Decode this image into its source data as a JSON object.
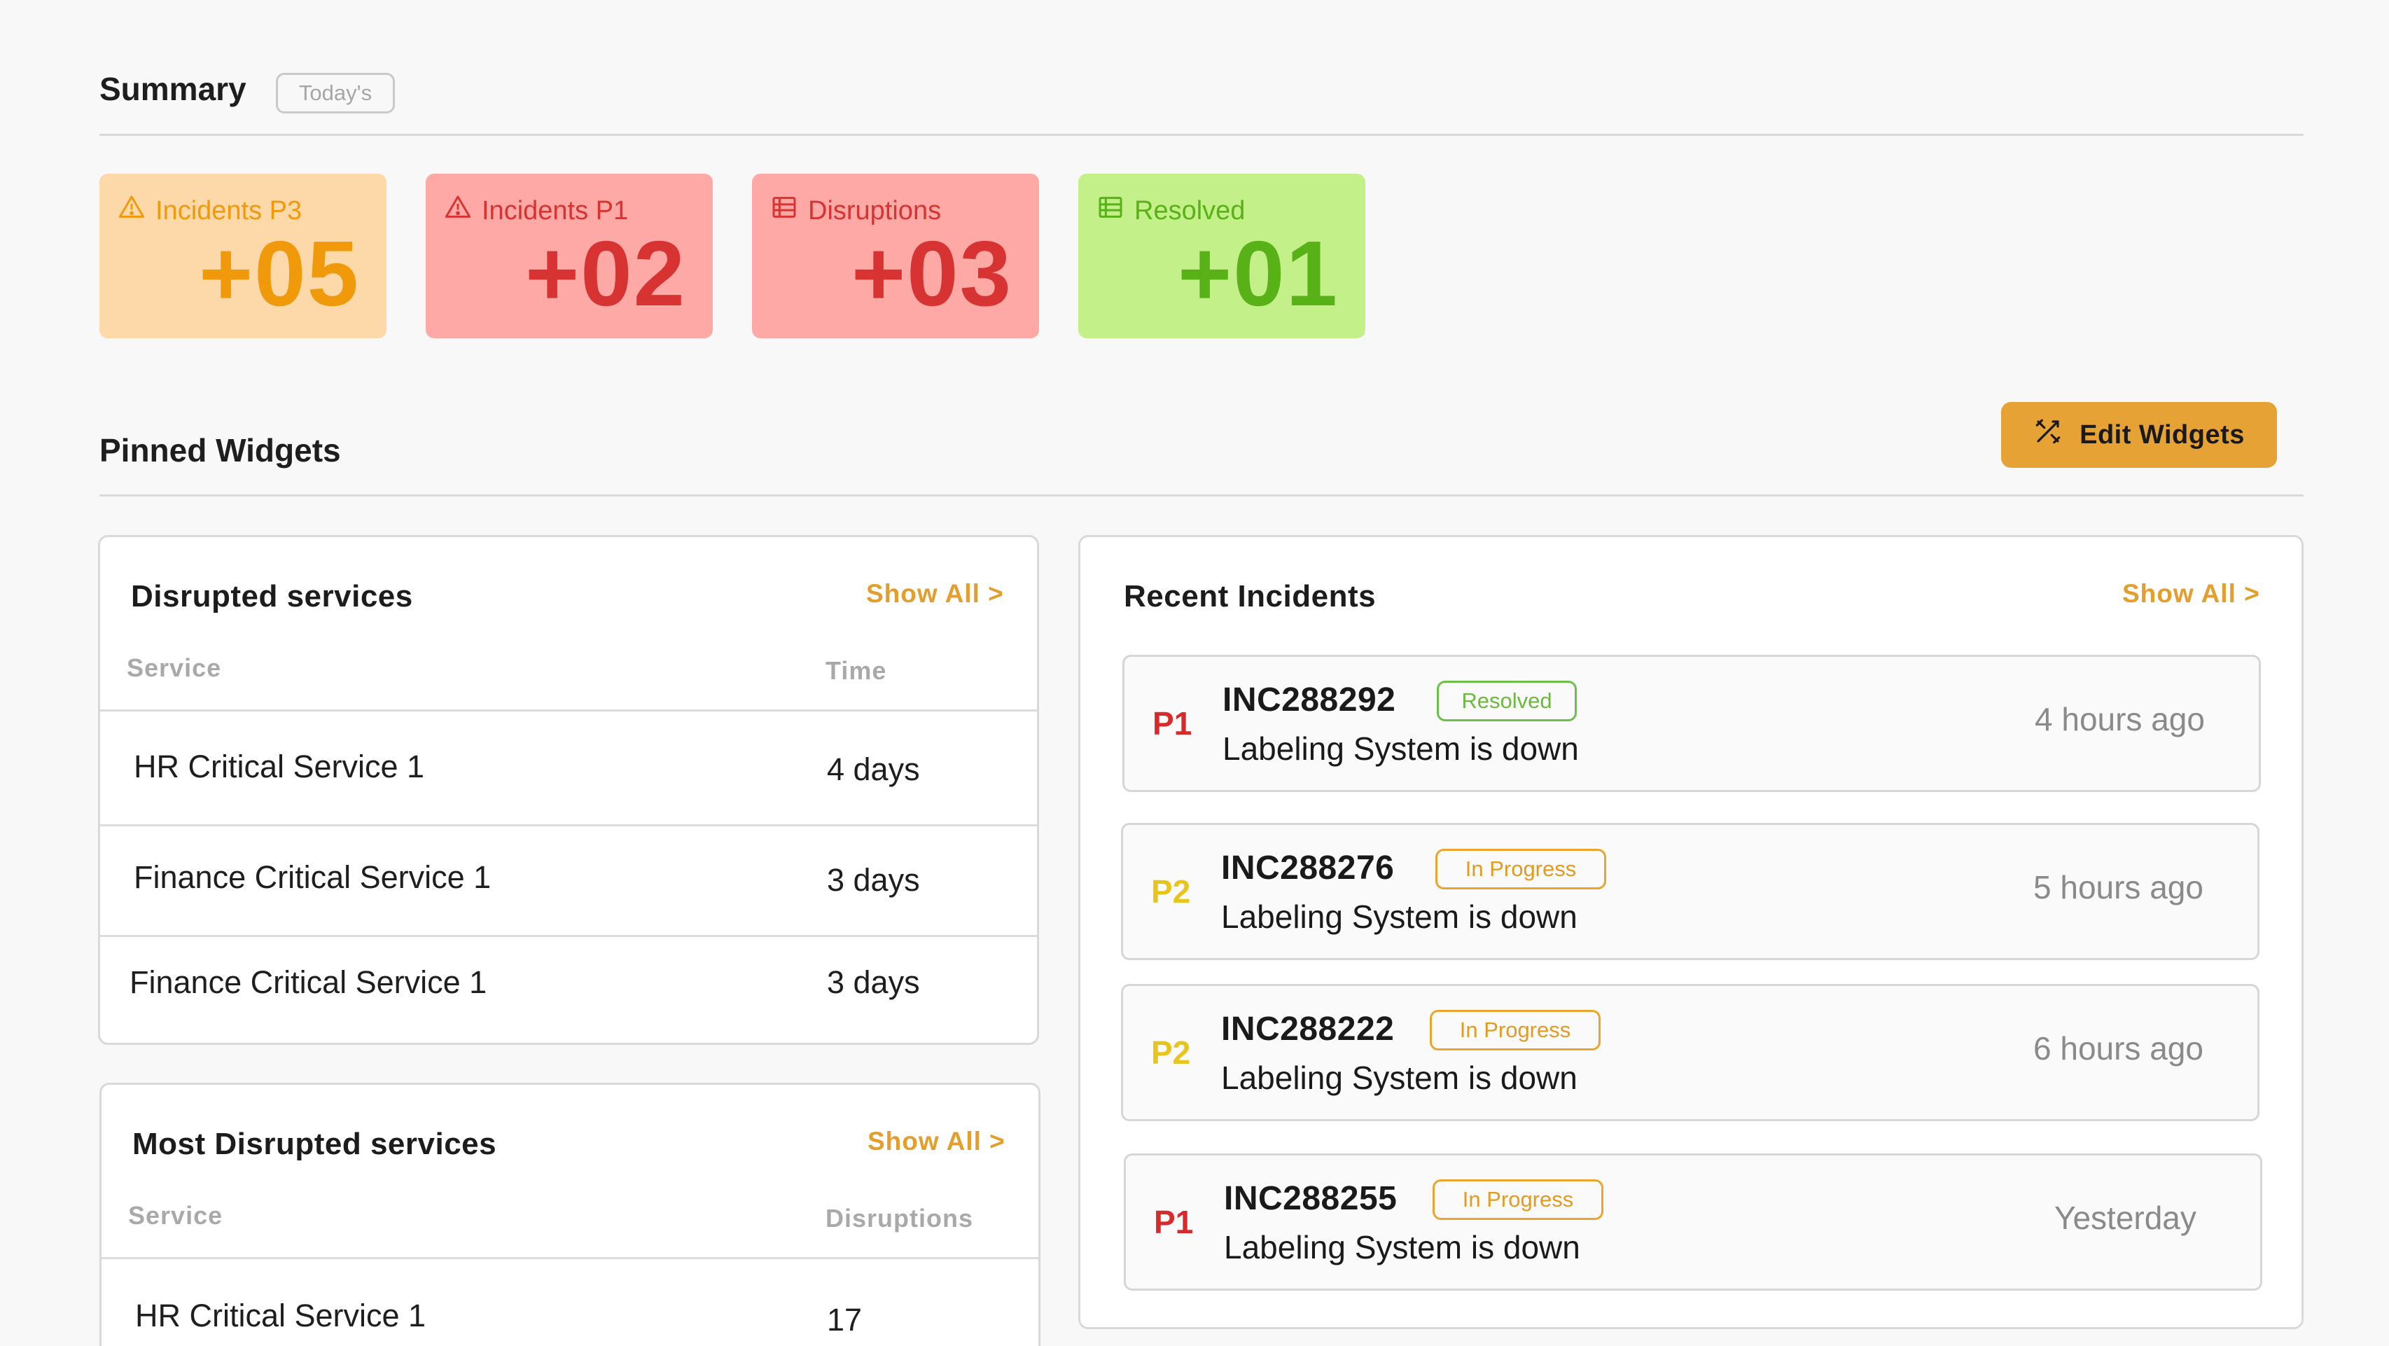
{
  "summary": {
    "title": "Summary",
    "badge": "Today's",
    "cards": [
      {
        "label": "Incidents P3",
        "value": "+05",
        "icon": "warning-triangle-icon"
      },
      {
        "label": "Incidents P1",
        "value": "+02",
        "icon": "warning-triangle-icon"
      },
      {
        "label": "Disruptions",
        "value": "+03",
        "icon": "list-icon"
      },
      {
        "label": "Resolved",
        "value": "+01",
        "icon": "list-icon"
      }
    ]
  },
  "pinned": {
    "title": "Pinned Widgets",
    "edit_label": "Edit Widgets"
  },
  "disrupted": {
    "title": "Disrupted services",
    "show_all": "Show All >",
    "col_service": "Service",
    "col_time": "Time",
    "rows": [
      {
        "service": "HR Critical Service 1",
        "time": "4 days"
      },
      {
        "service": "Finance Critical Service 1",
        "time": "3 days"
      },
      {
        "service": "Finance Critical Service 1",
        "time": "3 days"
      }
    ]
  },
  "most_disrupted": {
    "title": "Most Disrupted services",
    "show_all": "Show All >",
    "col_service": "Service",
    "col_disruptions": "Disruptions",
    "rows": [
      {
        "service": "HR Critical Service 1",
        "disruptions": "17"
      }
    ]
  },
  "recent": {
    "title": "Recent Incidents",
    "show_all": "Show All >",
    "items": [
      {
        "priority": "P1",
        "id": "INC288292",
        "status": "Resolved",
        "desc": "Labeling System is down",
        "time": "4 hours ago"
      },
      {
        "priority": "P2",
        "id": "INC288276",
        "status": "In Progress",
        "desc": "Labeling System is down",
        "time": "5 hours ago"
      },
      {
        "priority": "P2",
        "id": "INC288222",
        "status": "In Progress",
        "desc": "Labeling System is down",
        "time": "6 hours ago"
      },
      {
        "priority": "P1",
        "id": "INC288255",
        "status": "In Progress",
        "desc": "Labeling System is down",
        "time": "Yesterday"
      }
    ]
  },
  "colors": {
    "accent": "#e7a236",
    "p1": "#d62b2b",
    "p2": "#e8c51d",
    "p3": "#f09a0b",
    "resolved": "#59b118"
  }
}
